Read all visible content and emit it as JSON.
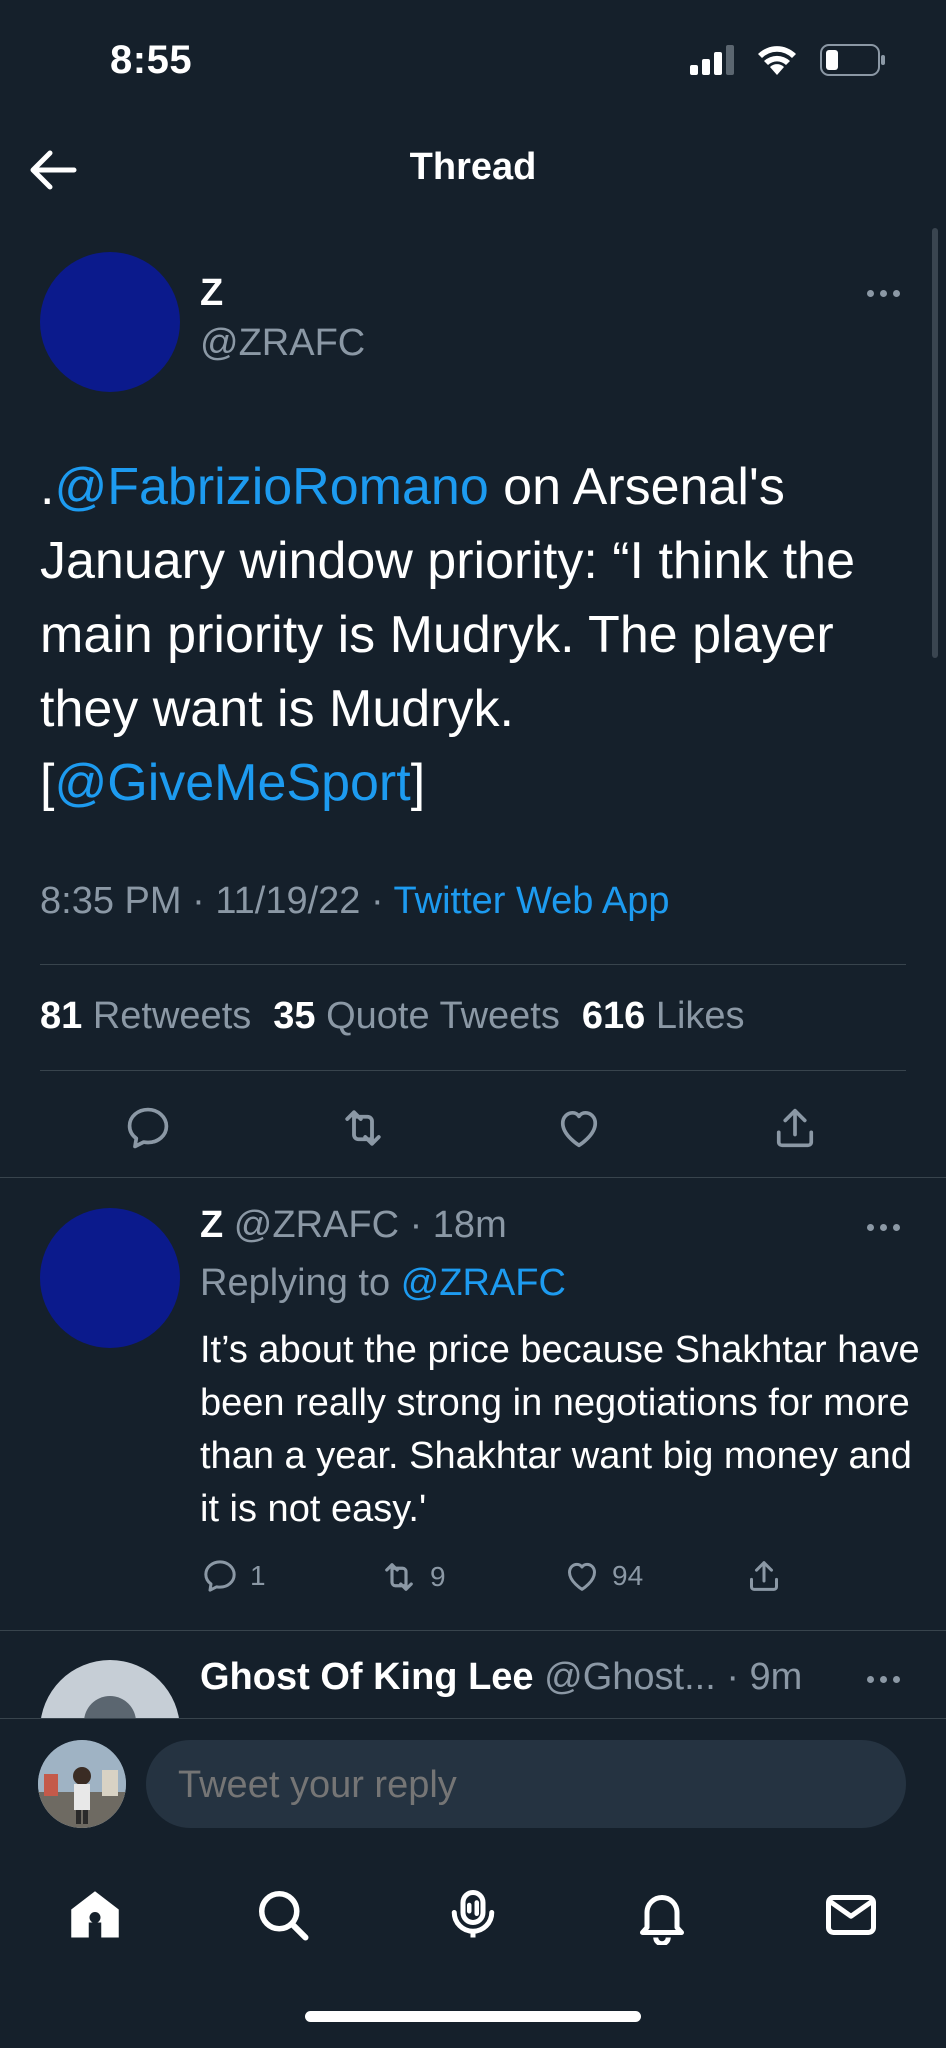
{
  "status_bar": {
    "time": "8:55"
  },
  "header": {
    "title": "Thread"
  },
  "main_tweet": {
    "name": "Z",
    "handle": "@ZRAFC",
    "text_prefix": ".",
    "mention1": "@FabrizioRomano",
    "text_body": " on Arsenal's January window priority: “I think the main priority is Mudryk. The player they want is Mudryk. [",
    "mention2": "@GiveMeSport",
    "text_suffix": "]",
    "time": "8:35 PM",
    "date": "11/19/22",
    "dot": " · ",
    "source": "Twitter Web App",
    "retweets_count": "81",
    "retweets_label": "Retweets",
    "quotes_count": "35",
    "quotes_label": "Quote Tweets",
    "likes_count": "616",
    "likes_label": "Likes"
  },
  "reply_tweet": {
    "name": "Z",
    "handle": "@ZRAFC",
    "time": "18m",
    "replying_label": "Replying to",
    "replying_to": "@ZRAFC",
    "text": "It’s about the price because Shakhtar have been really strong in negotiations for more than a year. Shakhtar want big money and it is not easy.'",
    "replies": "1",
    "retweets": "9",
    "likes": "94"
  },
  "next_tweet": {
    "name": "Ghost Of King Lee",
    "handle": "@Ghost...",
    "time": "9m"
  },
  "composer": {
    "placeholder": "Tweet your reply"
  },
  "colors": {
    "background": "#15202b",
    "link": "#1d9bf0",
    "muted": "#8b98a5",
    "avatar": "#0b1a8c"
  },
  "icons": {
    "back": "arrow-left-icon",
    "more": "more-icon",
    "reply": "reply-icon",
    "retweet": "retweet-icon",
    "like": "heart-icon",
    "share": "share-icon",
    "tabs": [
      "home-icon",
      "search-icon",
      "spaces-icon",
      "bell-icon",
      "mail-icon"
    ]
  }
}
